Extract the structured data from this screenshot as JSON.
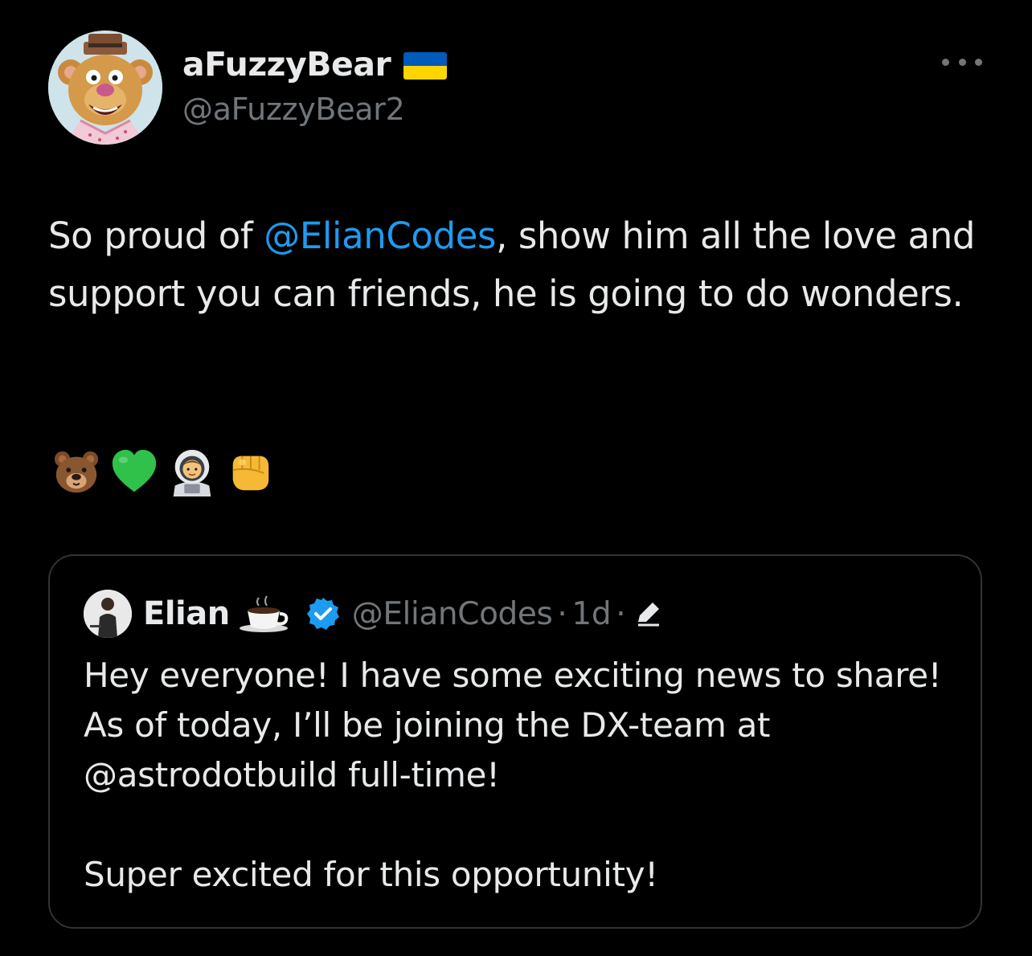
{
  "author": {
    "display_name": "aFuzzyBear",
    "handle": "@aFuzzyBear2",
    "flag_colors": {
      "top": "#005bbb",
      "bottom": "#ffd500"
    }
  },
  "more_icon": "more-horizontal-icon",
  "tweet": {
    "text_before": "So proud of ",
    "mention": "@ElianCodes",
    "text_after": ", show him all the love and support you can friends, he is going to do wonders.",
    "emojis": [
      "bear-face-emoji",
      "green-heart-emoji",
      "astronaut-emoji",
      "oncoming-fist-emoji"
    ]
  },
  "quoted": {
    "display_name": "Elian",
    "name_emoji": "hot-beverage-emoji",
    "verified_icon": "verified-badge-icon",
    "handle": "@ElianCodes",
    "separator": "·",
    "time": "1d",
    "edit_icon": "edited-pencil-icon",
    "paragraphs": [
      "Hey everyone! I have some exciting news to share!",
      "As of today, I’ll be joining the DX-team at",
      "@astrodotbuild full-time!",
      "",
      "Super excited for this opportunity!"
    ]
  },
  "colors": {
    "background": "#000000",
    "text": "#e7e9ea",
    "secondary": "#71767b",
    "link": "#1d9bf0",
    "border": "#2f3336",
    "verified": "#1d9bf0"
  }
}
